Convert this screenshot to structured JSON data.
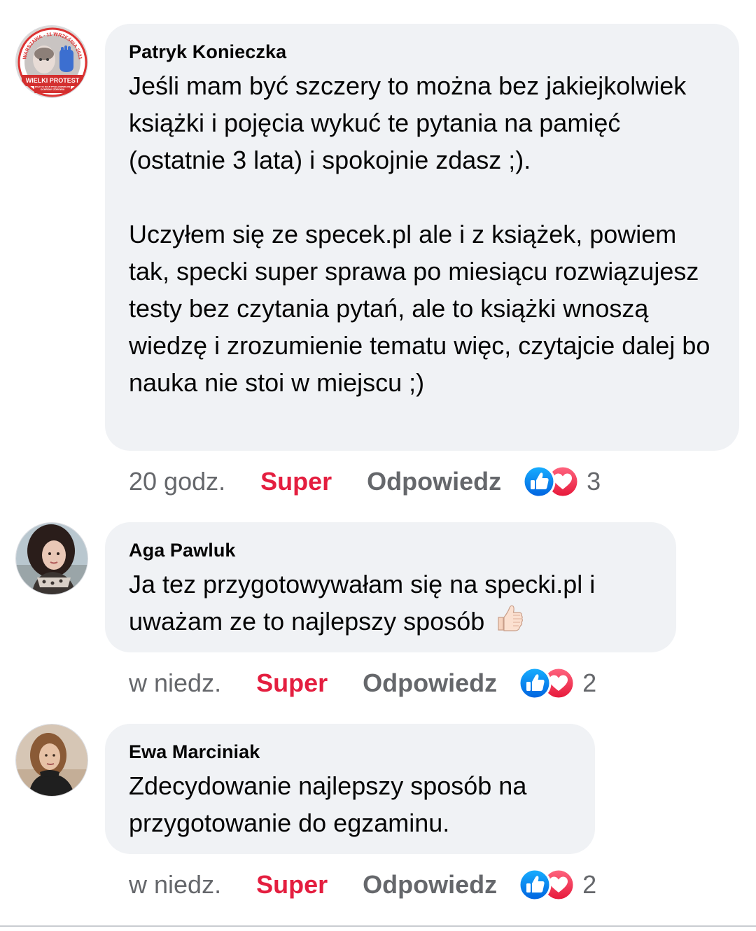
{
  "comments": [
    {
      "author": "Patryk Konieczka",
      "paragraphs": [
        "Jeśli mam być szczery to można bez jakiejkolwiek książki i pojęcia wykuć te pytania na pamięć (ostatnie 3 lata) i spokojnie zdasz ;).",
        "Uczyłem się ze specek.pl ale i z książek, powiem tak, specki super sprawa po miesiącu rozwiązujesz testy bez czytania pytań, ale to książki wnoszą wiedzę i zrozumienie tematu więc, czytajcie dalej bo nauka nie stoi w miejscu ;)"
      ],
      "time": "20 godz.",
      "reaction_label": "Super",
      "reply_label": "Odpowiedz",
      "reaction_count": "3",
      "avatar_badge": {
        "top": "WARSZAWA - 11 WRZEŚNIA 2021",
        "main": "WIELKI PROTEST",
        "sub": "WSZYSTKICH PRACOWNIKÓW OCHRONY ZDROWIA"
      },
      "reaction_icons": [
        "like-icon",
        "heart-icon"
      ]
    },
    {
      "author": "Aga Pawluk",
      "paragraphs": [
        "Ja tez przygotowywałam się na specki.pl i uważam ze to najlepszy sposób"
      ],
      "emoji": "thumbs-up-emoji",
      "time": "w niedz.",
      "reaction_label": "Super",
      "reply_label": "Odpowiedz",
      "reaction_count": "2",
      "reaction_icons": [
        "like-icon",
        "heart-icon"
      ]
    },
    {
      "author": "Ewa Marciniak",
      "paragraphs": [
        "Zdecydowanie najlepszy sposób na przygotowanie do egzaminu."
      ],
      "time": "w niedz.",
      "reaction_label": "Super",
      "reply_label": "Odpowiedz",
      "reaction_count": "2",
      "reaction_icons": [
        "like-icon",
        "heart-icon"
      ]
    }
  ],
  "colors": {
    "bubble": "#f0f2f5",
    "super": "#e41e3f",
    "secondary_text": "#65676b",
    "like_blue": "#1877f2",
    "love_red": "#f33e58"
  }
}
